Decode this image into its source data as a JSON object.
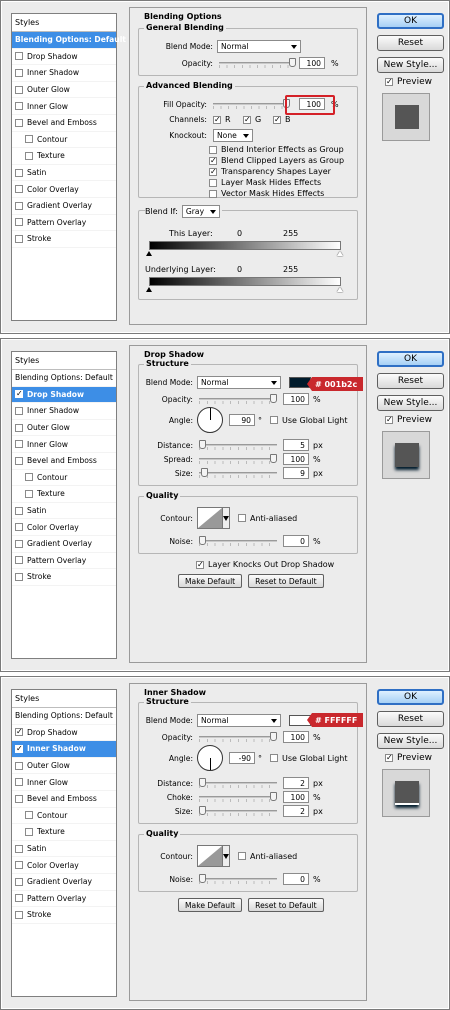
{
  "labels": {
    "styles": "Styles",
    "ok": "OK",
    "reset": "Reset",
    "new_style": "New Style...",
    "preview": "Preview",
    "make_default": "Make Default",
    "reset_default": "Reset to Default"
  },
  "style_list": [
    {
      "label": "Blending Options: Default",
      "sub": false,
      "checkbox": false
    },
    {
      "label": "Drop Shadow",
      "sub": false,
      "checkbox": true
    },
    {
      "label": "Inner Shadow",
      "sub": false,
      "checkbox": true
    },
    {
      "label": "Outer Glow",
      "sub": false,
      "checkbox": true
    },
    {
      "label": "Inner Glow",
      "sub": false,
      "checkbox": true
    },
    {
      "label": "Bevel and Emboss",
      "sub": false,
      "checkbox": true
    },
    {
      "label": "Contour",
      "sub": true,
      "checkbox": true
    },
    {
      "label": "Texture",
      "sub": true,
      "checkbox": true
    },
    {
      "label": "Satin",
      "sub": false,
      "checkbox": true
    },
    {
      "label": "Color Overlay",
      "sub": false,
      "checkbox": true
    },
    {
      "label": "Gradient Overlay",
      "sub": false,
      "checkbox": true
    },
    {
      "label": "Pattern Overlay",
      "sub": false,
      "checkbox": true
    },
    {
      "label": "Stroke",
      "sub": false,
      "checkbox": true
    }
  ],
  "dialog1": {
    "selected": 0,
    "checked": [],
    "title": "Blending Options",
    "general_title": "General Blending",
    "blend_mode_label": "Blend Mode:",
    "blend_mode": "Normal",
    "opacity_label": "Opacity:",
    "opacity": "100",
    "opacity_unit": "%",
    "advanced_title": "Advanced Blending",
    "fill_opacity_label": "Fill Opacity:",
    "fill_opacity": "100",
    "fill_unit": "%",
    "channels_label": "Channels:",
    "channel_r": "R",
    "channel_g": "G",
    "channel_b": "B",
    "knockout_label": "Knockout:",
    "knockout": "None",
    "opts": [
      {
        "label": "Blend Interior Effects as Group",
        "checked": false
      },
      {
        "label": "Blend Clipped Layers as Group",
        "checked": true
      },
      {
        "label": "Transparency Shapes Layer",
        "checked": true
      },
      {
        "label": "Layer Mask Hides Effects",
        "checked": false
      },
      {
        "label": "Vector Mask Hides Effects",
        "checked": false
      }
    ],
    "blend_if_label": "Blend If:",
    "blend_if": "Gray",
    "this_layer_label": "This Layer:",
    "this_layer_lo": "0",
    "this_layer_hi": "255",
    "underlying_label": "Underlying Layer:",
    "underlying_lo": "0",
    "underlying_hi": "255",
    "preview_color": "#5a5a5a"
  },
  "dialog2": {
    "selected": 1,
    "checked": [
      1
    ],
    "title": "Drop Shadow",
    "structure_title": "Structure",
    "blend_mode_label": "Blend Mode:",
    "blend_mode": "Normal",
    "color": "#001b2c",
    "color_callout": "# 001b2c",
    "opacity_label": "Opacity:",
    "opacity": "100",
    "pct": "%",
    "angle_label": "Angle:",
    "angle": "90",
    "deg": "°",
    "global_light": "Use Global Light",
    "distance_label": "Distance:",
    "distance": "5",
    "px": "px",
    "spread_label": "Spread:",
    "spread": "100",
    "size_label": "Size:",
    "size": "9",
    "quality_title": "Quality",
    "contour_label": "Contour:",
    "anti_aliased": "Anti-aliased",
    "noise_label": "Noise:",
    "noise": "0",
    "knockout_label": "Layer Knocks Out Drop Shadow"
  },
  "dialog3": {
    "selected": 2,
    "checked": [
      1,
      2
    ],
    "title": "Inner Shadow",
    "structure_title": "Structure",
    "blend_mode_label": "Blend Mode:",
    "blend_mode": "Normal",
    "color": "#ffffff",
    "color_callout": "# FFFFFF",
    "opacity_label": "Opacity:",
    "opacity": "100",
    "pct": "%",
    "angle_label": "Angle:",
    "angle": "-90",
    "deg": "°",
    "global_light": "Use Global Light",
    "distance_label": "Distance:",
    "distance": "2",
    "px": "px",
    "choke_label": "Choke:",
    "choke": "100",
    "size_label": "Size:",
    "size": "2",
    "quality_title": "Quality",
    "contour_label": "Contour:",
    "anti_aliased": "Anti-aliased",
    "noise_label": "Noise:",
    "noise": "0"
  }
}
